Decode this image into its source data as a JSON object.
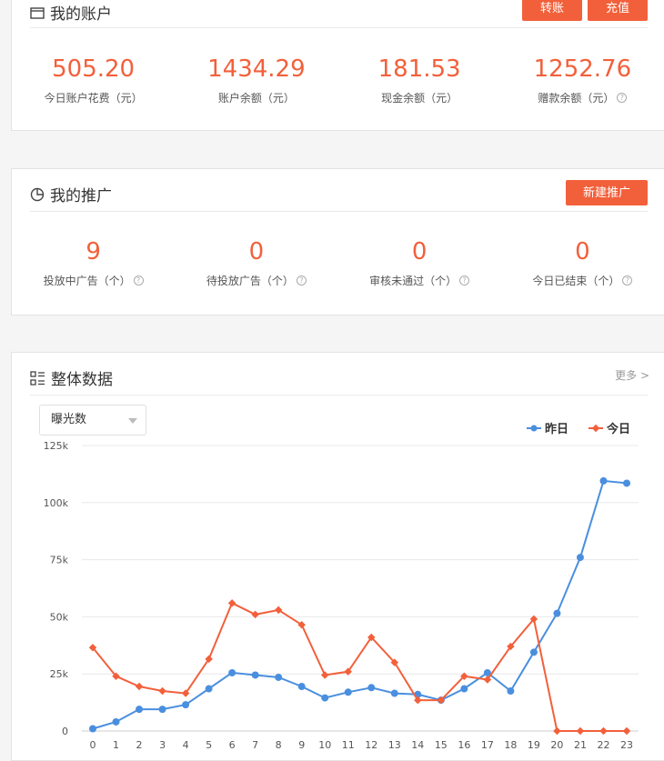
{
  "account": {
    "title": "我的账户",
    "transfer_label": "转账",
    "recharge_label": "充值",
    "stats": [
      {
        "value": "505.20",
        "label": "今日账户花费（元）",
        "help": false
      },
      {
        "value": "1434.29",
        "label": "账户余额（元）",
        "help": false
      },
      {
        "value": "181.53",
        "label": "现金余额（元）",
        "help": false
      },
      {
        "value": "1252.76",
        "label": "赠款余额（元）",
        "help": true
      }
    ]
  },
  "promotion": {
    "title": "我的推广",
    "new_label": "新建推广",
    "stats": [
      {
        "value": "9",
        "label": "投放中广告（个）",
        "help": true
      },
      {
        "value": "0",
        "label": "待投放广告（个）",
        "help": true
      },
      {
        "value": "0",
        "label": "审核未通过（个）",
        "help": true
      },
      {
        "value": "0",
        "label": "今日已结束（个）",
        "help": true
      }
    ]
  },
  "overview": {
    "title": "整体数据",
    "more_label": "更多",
    "metric_selected": "曝光数",
    "help_glyph": "?"
  },
  "colors": {
    "accent": "#f2603b",
    "yesterday": "#4a8fdf",
    "today": "#f2603b"
  },
  "chart_data": {
    "type": "line",
    "x": [
      0,
      1,
      2,
      3,
      4,
      5,
      6,
      7,
      8,
      9,
      10,
      11,
      12,
      13,
      14,
      15,
      16,
      17,
      18,
      19,
      20,
      21,
      22,
      23
    ],
    "ylim": [
      0,
      125000
    ],
    "yticks": [
      "0",
      "25k",
      "50k",
      "75k",
      "100k",
      "125k"
    ],
    "grid": true,
    "legend_position": "top-right",
    "series": [
      {
        "name": "昨日",
        "color": "#4a8fdf",
        "values": [
          1000,
          4000,
          9500,
          9500,
          11500,
          18500,
          25500,
          24500,
          23500,
          19500,
          14500,
          17000,
          19000,
          16500,
          16000,
          13500,
          18500,
          25500,
          17500,
          34500,
          51500,
          76000,
          109500,
          108500
        ]
      },
      {
        "name": "今日",
        "color": "#f2603b",
        "values": [
          36500,
          24000,
          19500,
          17500,
          16500,
          31500,
          56000,
          51000,
          53000,
          46500,
          24500,
          26000,
          41000,
          30000,
          13500,
          13500,
          24000,
          22500,
          37000,
          49000,
          0,
          0,
          0,
          0
        ]
      }
    ]
  }
}
